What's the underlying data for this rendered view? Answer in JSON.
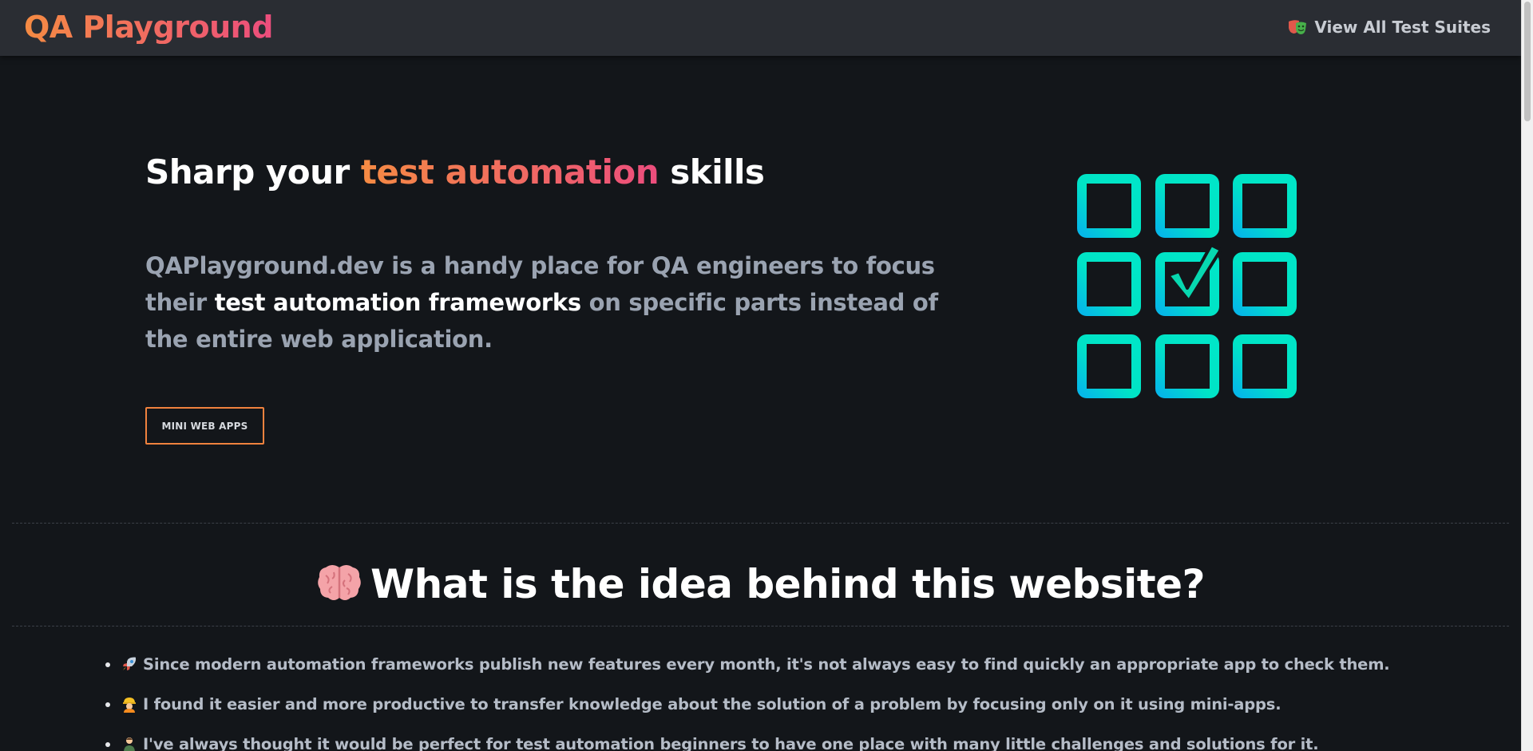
{
  "header": {
    "logo": "QA Playground",
    "nav_link": "View All Test Suites",
    "nav_icon": "theater-mask-icon"
  },
  "hero": {
    "title_prefix": "Sharp your ",
    "title_accent": "test automation",
    "title_suffix": " skills",
    "text_part1": "QAPlayground.dev is a handy place for QA engineers to focus their ",
    "text_strong": "test automation frameworks",
    "text_part2": " on specific parts instead of the entire web application.",
    "button_label": "MINI WEB APPS",
    "graphic": "checkbox-grid-icon"
  },
  "idea_section": {
    "heading": "What is the idea behind this website?",
    "heading_icon": "brain-icon",
    "items": [
      {
        "icon": "rocket-icon",
        "text": "Since modern automation frameworks publish new features every month, it's not always easy to find quickly an appropriate app to check them."
      },
      {
        "icon": "construction-worker-icon",
        "text": "I found it easier and more productive to transfer knowledge about the solution of a problem by focusing only on it using mini-apps."
      },
      {
        "icon": "person-icon",
        "text": "I've always thought it would be perfect for test automation beginners to have one place with many little challenges and solutions for it."
      }
    ]
  },
  "colors": {
    "background": "#13161a",
    "header": "#2a2d33",
    "accent_start": "#f58b43",
    "accent_end": "#ec4d7d",
    "graphic_teal": "#00e4c6",
    "graphic_blue": "#05b8e8"
  }
}
